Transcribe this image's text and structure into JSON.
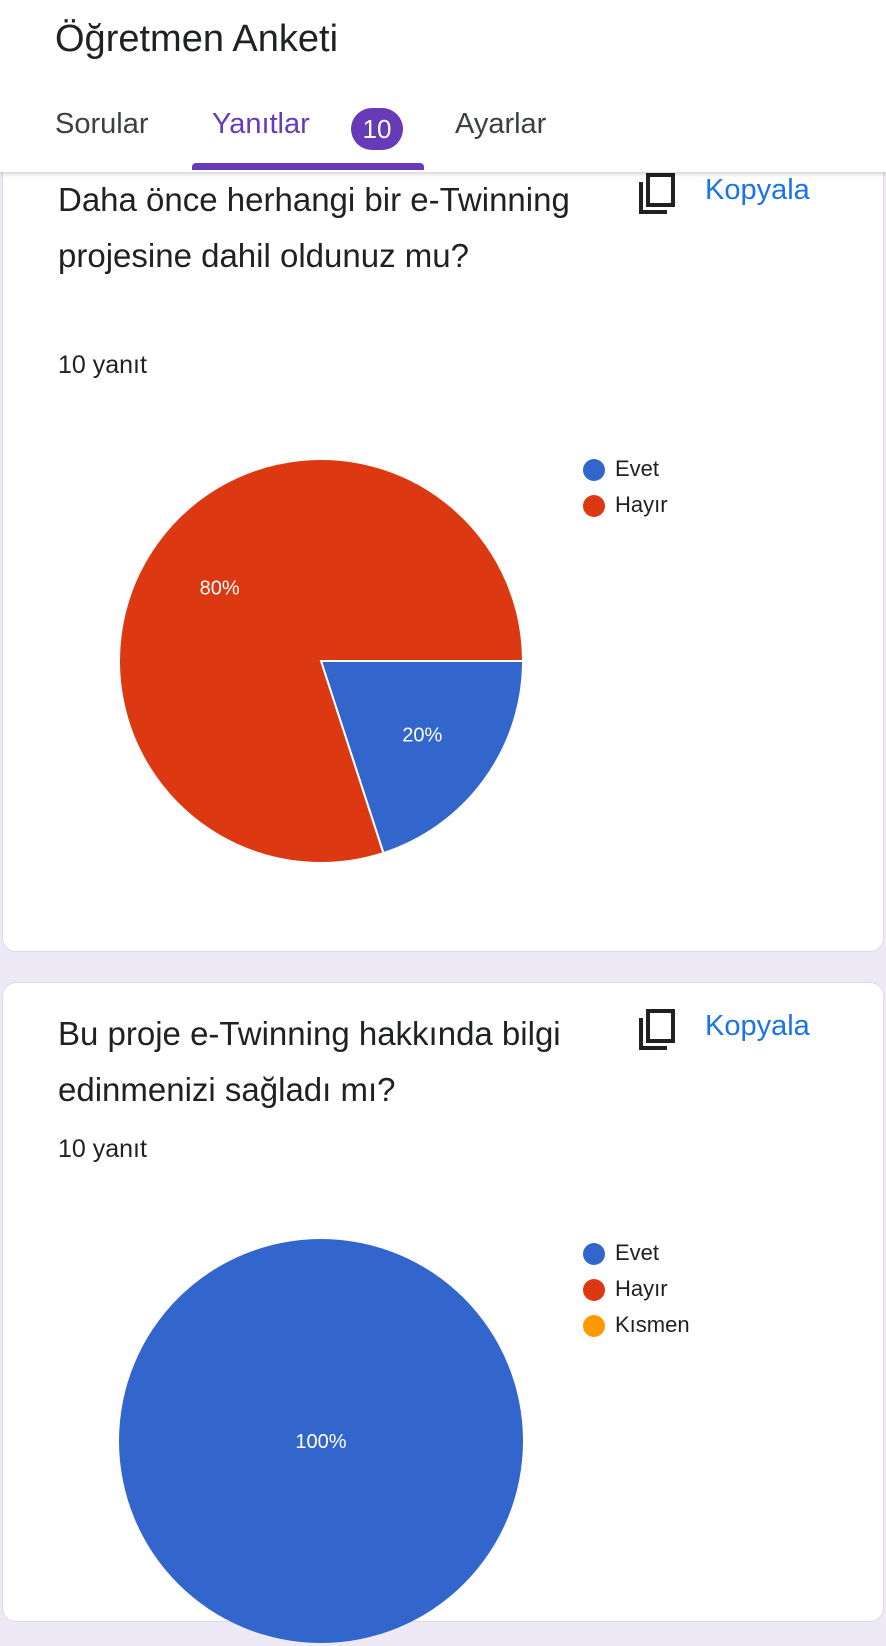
{
  "app": {
    "title": "Öğretmen Anketi",
    "tabs": {
      "sorular": "Sorular",
      "yanitlar": "Yanıtlar",
      "ayarlar": "Ayarlar"
    },
    "response_badge": "10",
    "accent_color": "#673ab7"
  },
  "copy_label": "Kopyala",
  "colors": {
    "Evet": "#3366cc",
    "Hayır": "#dc3912",
    "Kısmen": "#ff9900"
  },
  "questions": [
    {
      "title": "Daha önce herhangi bir e-Twinning projesine dahil oldunuz mu?",
      "count_label": "10 yanıt",
      "legend": [
        "Evet",
        "Hayır"
      ]
    },
    {
      "title": "Bu proje e-Twinning hakkında bilgi edinmenizi sağladı mı?",
      "count_label": "10 yanıt",
      "legend": [
        "Evet",
        "Hayır",
        "Kısmen"
      ]
    }
  ],
  "chart_data": [
    {
      "type": "pie",
      "categories": [
        "Evet",
        "Hayır"
      ],
      "values": [
        20,
        80
      ],
      "labels": [
        "20%",
        "80%"
      ],
      "legend_position": "right"
    },
    {
      "type": "pie",
      "categories": [
        "Evet",
        "Hayır",
        "Kısmen"
      ],
      "values": [
        100,
        0,
        0
      ],
      "labels": [
        "100%",
        "",
        ""
      ],
      "legend_position": "right"
    }
  ]
}
